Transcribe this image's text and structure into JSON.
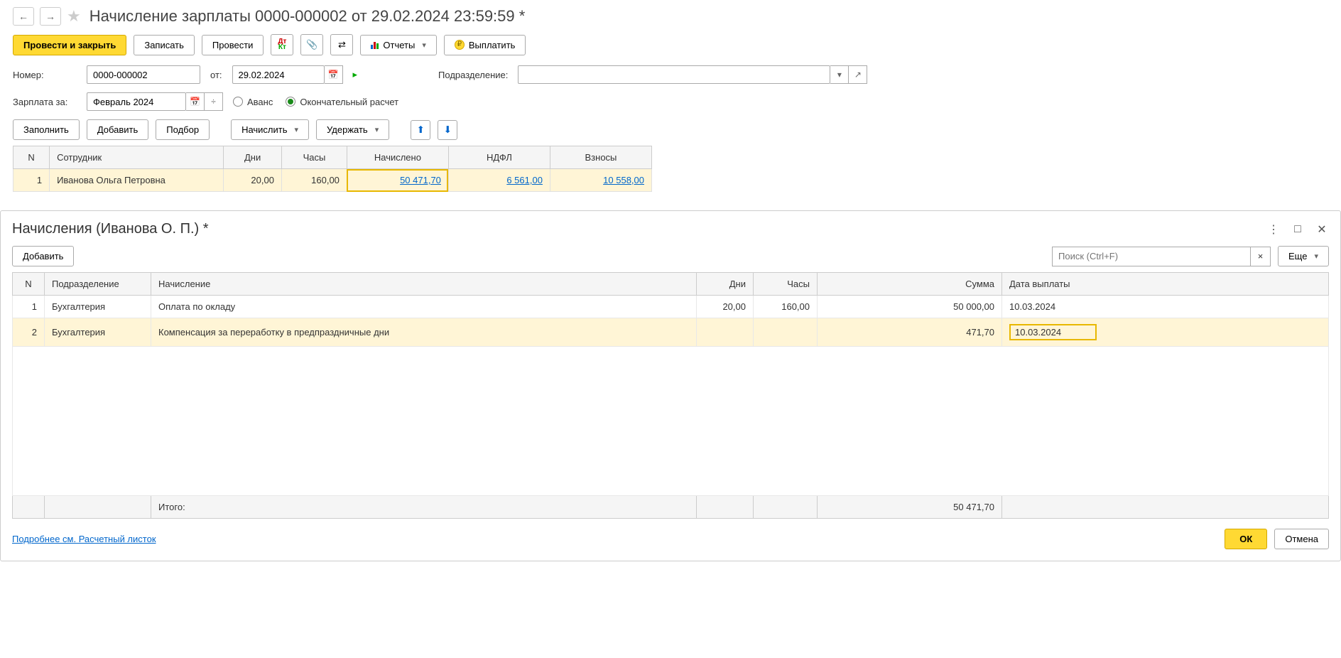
{
  "header": {
    "title": "Начисление зарплаты 0000-000002 от 29.02.2024 23:59:59 *"
  },
  "toolbar": {
    "post_and_close": "Провести и закрыть",
    "save": "Записать",
    "post": "Провести",
    "reports": "Отчеты",
    "pay": "Выплатить"
  },
  "form": {
    "number_label": "Номер:",
    "number_value": "0000-000002",
    "date_label": "от:",
    "date_value": "29.02.2024",
    "department_label": "Подразделение:",
    "department_value": "",
    "salary_for_label": "Зарплата за:",
    "salary_for_value": "Февраль 2024",
    "advance_label": "Аванс",
    "final_label": "Окончательный расчет"
  },
  "table_toolbar": {
    "fill": "Заполнить",
    "add": "Добавить",
    "pick": "Подбор",
    "calculate": "Начислить",
    "deduct": "Удержать"
  },
  "main_table": {
    "headers": {
      "n": "N",
      "employee": "Сотрудник",
      "days": "Дни",
      "hours": "Часы",
      "accrued": "Начислено",
      "ndfl": "НДФЛ",
      "contrib": "Взносы"
    },
    "rows": [
      {
        "n": "1",
        "employee": "Иванова Ольга Петровна",
        "days": "20,00",
        "hours": "160,00",
        "accrued": "50 471,70",
        "ndfl": "6 561,00",
        "contrib": "10 558,00"
      }
    ]
  },
  "panel": {
    "title": "Начисления (Иванова О. П.) *",
    "add": "Добавить",
    "search_placeholder": "Поиск (Ctrl+F)",
    "more": "Еще",
    "headers": {
      "n": "N",
      "dept": "Подразделение",
      "accrual": "Начисление",
      "days": "Дни",
      "hours": "Часы",
      "sum": "Сумма",
      "pay_date": "Дата выплаты"
    },
    "rows": [
      {
        "n": "1",
        "dept": "Бухгалтерия",
        "accrual": "Оплата по окладу",
        "days": "20,00",
        "hours": "160,00",
        "sum": "50 000,00",
        "pay_date": "10.03.2024"
      },
      {
        "n": "2",
        "dept": "Бухгалтерия",
        "accrual": "Компенсация за переработку в предпраздничные дни",
        "days": "",
        "hours": "",
        "sum": "471,70",
        "pay_date": "10.03.2024"
      }
    ],
    "total_label": "Итого:",
    "total_sum": "50 471,70",
    "footer_link": "Подробнее см. Расчетный листок",
    "ok": "ОК",
    "cancel": "Отмена"
  }
}
